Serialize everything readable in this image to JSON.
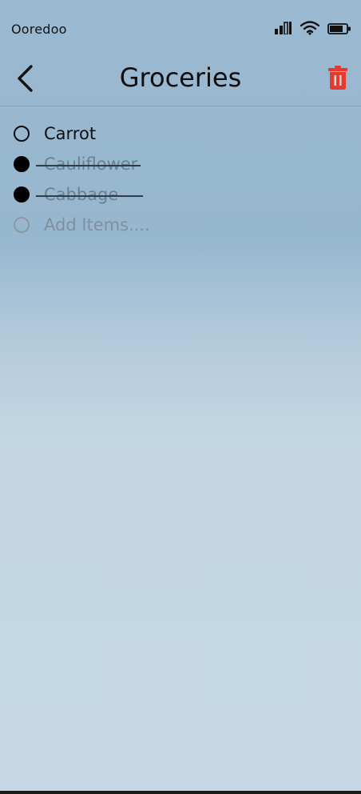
{
  "status_bar": {
    "carrier": "Ooredoo",
    "icons": [
      "cellular-signal-icon",
      "wifi-icon",
      "battery-icon"
    ]
  },
  "header": {
    "title": "Groceries",
    "back_icon": "chevron-left-icon",
    "delete_icon": "trash-icon"
  },
  "items": [
    {
      "label": "Carrot",
      "completed": false
    },
    {
      "label": "Cauliflower",
      "completed": true
    },
    {
      "label": "Cabbage",
      "completed": true
    }
  ],
  "add_item": {
    "placeholder": "Add Items...."
  },
  "colors": {
    "accent_delete": "#e53b2f",
    "background_top": "#9bb9d1",
    "background_bottom": "#c5d8e4"
  }
}
